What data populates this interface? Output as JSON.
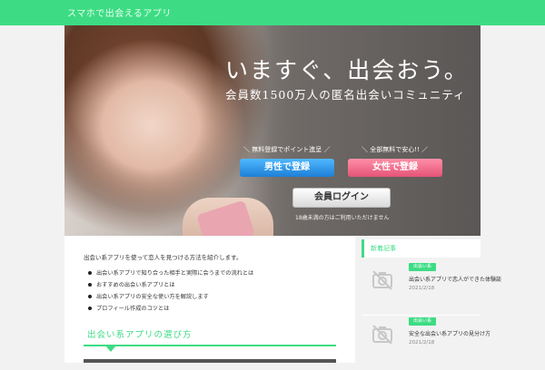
{
  "header": {
    "site_title": "スマホで出会えるアプリ"
  },
  "hero": {
    "headline": "いますぐ、出会おう。",
    "subhead": "会員数1500万人の匿名出会いコミュニティ",
    "male_note": "＼ 無料登録でポイント進呈 ／",
    "female_note": "＼ 全部無料で安心!! ／",
    "male_button": "男性で登録",
    "female_button": "女性で登録",
    "login_button": "会員ログイン",
    "age_note": "18歳未満の方はご利用いただけません"
  },
  "main": {
    "intro": "出会い系アプリを使って恋人を見つける方法を紹介します。",
    "bullets": [
      "出会い系アプリで知り合った相手と実際に会うまでの流れとは",
      "おすすめの出会い系アプリとは",
      "出会い系アプリの安全な使い方を解説します",
      "プロフィール作成のコツとは"
    ],
    "section_title": "出会い系アプリの選び方"
  },
  "sidebar": {
    "title": "新着記事",
    "posts": [
      {
        "tag": "出会い系",
        "title": "出会い系アプリで恋人ができた体験談",
        "date": "2021/2/18"
      },
      {
        "tag": "出会い系",
        "title": "安全な出会い系アプリの見分け方",
        "date": "2021/2/18"
      }
    ]
  },
  "colors": {
    "accent": "#3ddc84",
    "male": "#1e7fd6",
    "female": "#e55377"
  },
  "icons": {
    "thumbnail": "no-image-icon"
  }
}
